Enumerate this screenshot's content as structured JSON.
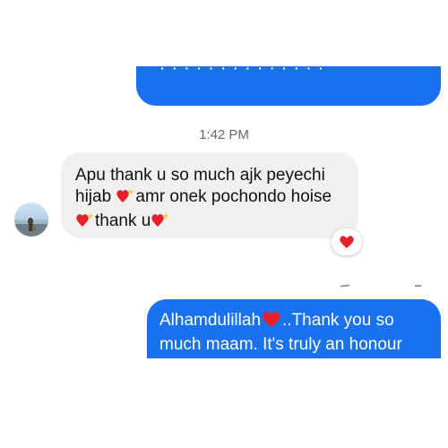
{
  "messages": {
    "top_outgoing_cut": "· · · · · · · · · · · · · ·",
    "timestamp": "1:42 PM",
    "incoming": {
      "line1": "Apu thank u so much ajk peyechi",
      "line2a": "hijab ",
      "line2b": "amr onek pochondo hoise",
      "line3": "thank u",
      "reaction_icon": "heart-reaction-icon"
    },
    "outgoing": {
      "part1": "Alhamdulillah",
      "part2": "..Thank you so",
      "line2": "much maam. It's truly an honour"
    }
  },
  "colors": {
    "outgoing_bubble": "#1a72f2",
    "incoming_bubble": "#f1f0f0",
    "heart": "#e8202a"
  }
}
